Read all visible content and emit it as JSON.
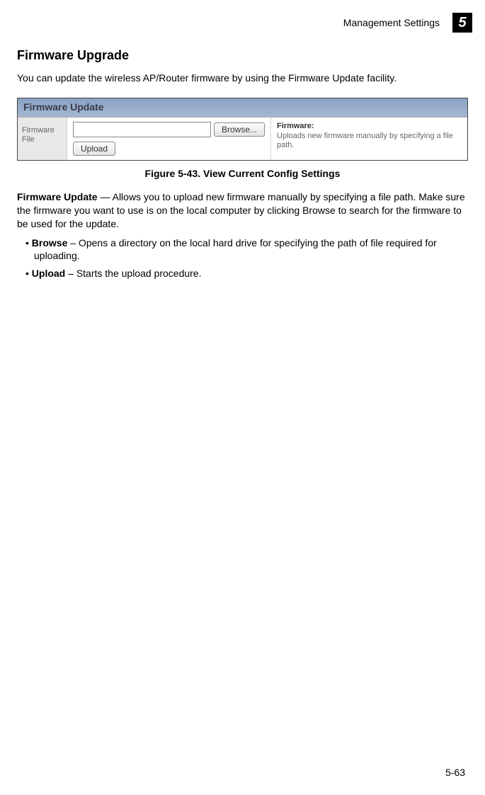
{
  "header": {
    "section_label": "Management Settings",
    "chapter_number": "5"
  },
  "section": {
    "title": "Firmware Upgrade",
    "intro": "You can update the wireless AP/Router firmware by using the Firmware Update facility."
  },
  "screenshot": {
    "titlebar": "Firmware Update",
    "left_label": "Firmware File",
    "browse_label": "Browse...",
    "upload_label": "Upload",
    "right_title": "Firmware:",
    "right_desc": "Uploads new firmware manually by specifying a file path."
  },
  "figure_caption": "Figure 5-43.   View Current Config Settings",
  "body": {
    "firmware_update_bold": "Firmware Update",
    "firmware_update_rest": " — Allows you to upload new firmware manually by specifying a file path. Make sure the firmware you want to use is on the local computer by clicking Browse to search for the firmware to be used for the update.",
    "browse_bold": "Browse",
    "browse_rest": " – Opens a directory on the local hard drive for specifying the path of file required for uploading.",
    "upload_bold": "Upload",
    "upload_rest": " – Starts the upload procedure."
  },
  "page_number": "5-63"
}
